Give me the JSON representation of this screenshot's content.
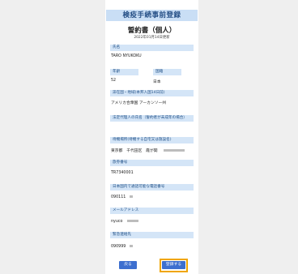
{
  "header": {
    "title": "検疫手続事前登録"
  },
  "document": {
    "title": "誓約書（個人）",
    "date": "2022年01月14日更新"
  },
  "fields": {
    "name": {
      "label": "氏名",
      "value": "TARO  NYUKOKU"
    },
    "age": {
      "label": "年齢",
      "value": "52"
    },
    "nationality": {
      "label": "国籍",
      "value": "日本"
    },
    "departure": {
      "label": "滞在国・地域(本邦入国14日前)",
      "value": "アメリカ合衆国 アーカンソー州"
    },
    "guardian": {
      "label": "法定代理人の氏名（誓約者が未成年の場合）",
      "value": ""
    },
    "destination": {
      "label": "待機場所(待機する自宅又は施設名)",
      "value": "東京都　千代田区　霞が関"
    },
    "passport": {
      "label": "旅券番号",
      "value": "TR7340001"
    },
    "phone": {
      "label": "日本国内で通話可能な電話番号",
      "value": "090111"
    },
    "email": {
      "label": "メールアドレス",
      "value": "nyuco"
    },
    "emergency": {
      "label": "緊急連絡先",
      "value": "090999"
    }
  },
  "buttons": {
    "back": "戻る",
    "register": "登録する"
  },
  "colors": {
    "label_bg": "#d4e5f7",
    "header_bg": "#c9def5",
    "button": "#3d6fcf",
    "highlight": "#f0a500"
  }
}
